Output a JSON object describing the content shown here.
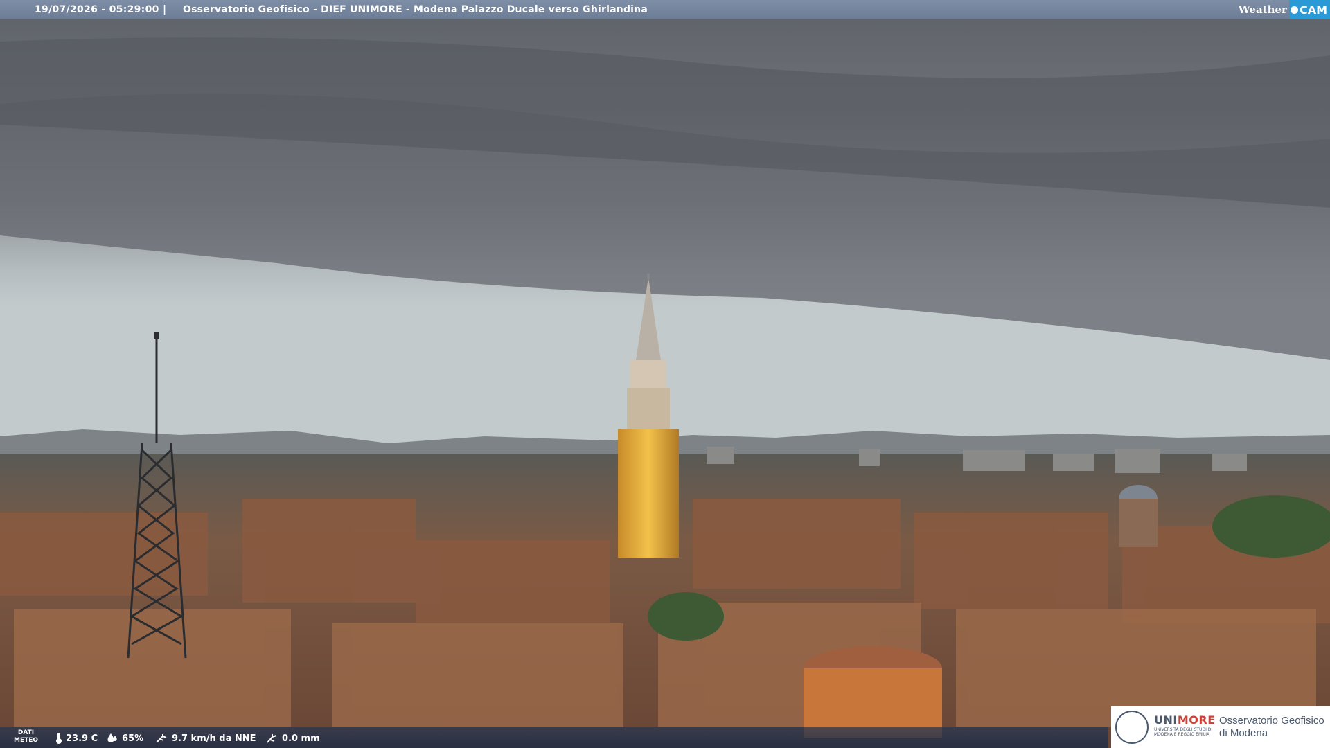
{
  "header": {
    "timestamp": "19/07/2026 - 05:29:00",
    "separator": "|",
    "title": "Osservatorio Geofisico - DIEF UNIMORE - Modena Palazzo Ducale verso Ghirlandina"
  },
  "brand": {
    "weather": "Weather",
    "cam": "CAM",
    "accent": "#2a9ad6"
  },
  "weather_data": {
    "label_line1": "DATI",
    "label_line2": "METEO",
    "temperature": "23.9 C",
    "humidity": "65%",
    "wind": "9.7 km/h da NNE",
    "rain": "0.0 mm"
  },
  "logo": {
    "uni_a": "UNI",
    "uni_b": "MORE",
    "subtitle": "UNIVERSITÀ DEGLI STUDI DI MODENA E REGGIO EMILIA",
    "org_line1": "Osservatorio Geofisico",
    "org_line2": "di Modena"
  }
}
